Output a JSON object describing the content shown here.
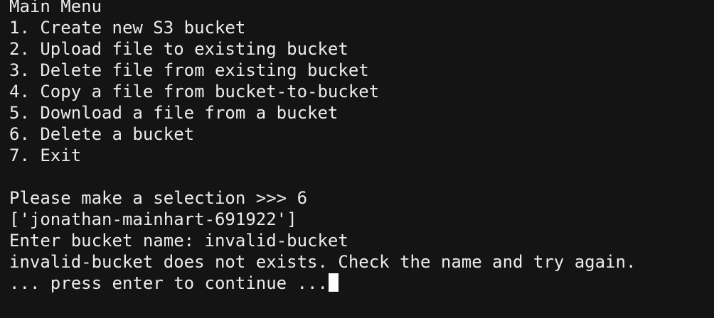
{
  "terminal": {
    "menu_title": "Main Menu",
    "menu_items": [
      "1. Create new S3 bucket",
      "2. Upload file to existing bucket",
      "3. Delete file from existing bucket",
      "4. Copy a file from bucket-to-bucket",
      "5. Download a file from a bucket",
      "6. Delete a bucket",
      "7. Exit"
    ],
    "selection_prompt": "Please make a selection >>> 6",
    "bucket_list": "['jonathan-mainhart-691922']",
    "bucket_name_prompt": "Enter bucket name: invalid-bucket",
    "error_message": "invalid-bucket does not exists. Check the name and try again.",
    "continue_prompt": "... press enter to continue ..."
  }
}
